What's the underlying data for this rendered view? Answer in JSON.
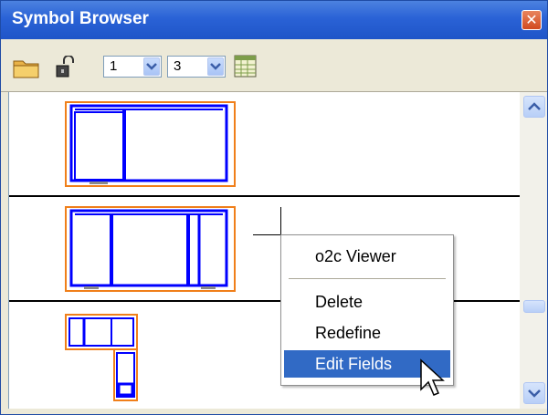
{
  "window": {
    "title": "Symbol Browser",
    "close_glyph": "✕"
  },
  "toolbar": {
    "open_icon": "folder-icon",
    "lock_icon": "unlock-icon",
    "combo1_value": "1",
    "combo2_value": "3",
    "grid_icon": "table-icon"
  },
  "context_menu": {
    "items": [
      {
        "label": "o2c Viewer"
      },
      {
        "label": "Delete"
      },
      {
        "label": "Redefine"
      },
      {
        "label": "Edit Fields",
        "highlighted": true
      }
    ]
  },
  "colors": {
    "title_bar": "#2a62d6",
    "symbol_frame": "#0000ff",
    "symbol_outline": "#f07f1a",
    "menu_highlight": "#316ac5"
  }
}
